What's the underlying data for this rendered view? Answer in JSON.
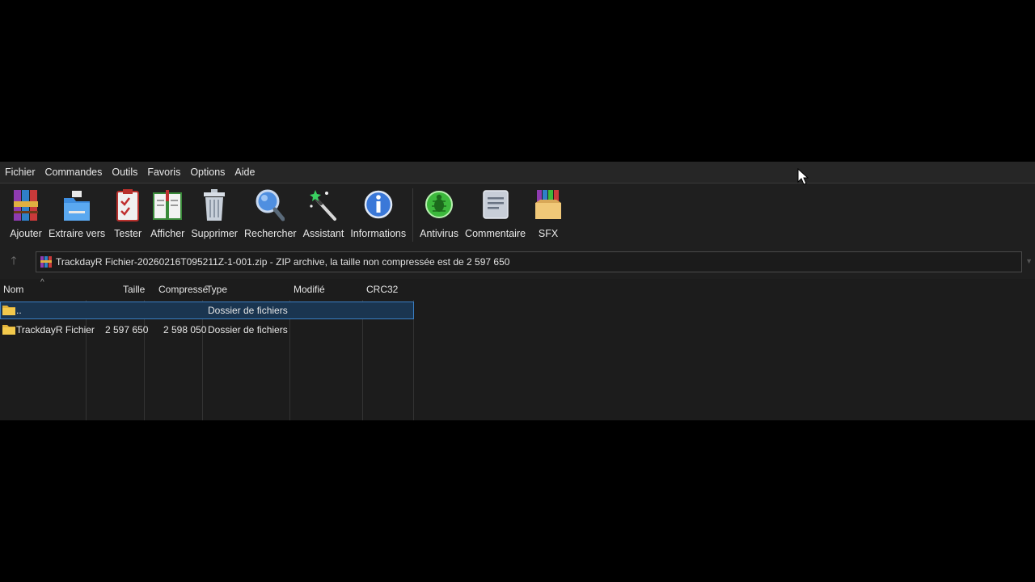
{
  "menubar": {
    "items": [
      "Fichier",
      "Commandes",
      "Outils",
      "Favoris",
      "Options",
      "Aide"
    ]
  },
  "toolbar": {
    "buttons": [
      {
        "label": "Ajouter",
        "icon": "winrar-books-icon"
      },
      {
        "label": "Extraire vers",
        "icon": "extract-folder-icon"
      },
      {
        "label": "Tester",
        "icon": "clipboard-check-icon"
      },
      {
        "label": "Afficher",
        "icon": "open-book-icon"
      },
      {
        "label": "Supprimer",
        "icon": "trash-can-icon"
      },
      {
        "label": "Rechercher",
        "icon": "magnifier-icon"
      },
      {
        "label": "Assistant",
        "icon": "magic-wand-icon"
      },
      {
        "label": "Informations",
        "icon": "info-icon"
      },
      {
        "label": "Antivirus",
        "icon": "bug-shield-icon"
      },
      {
        "label": "Commentaire",
        "icon": "comment-icon"
      },
      {
        "label": "SFX",
        "icon": "sfx-box-icon"
      }
    ]
  },
  "address": {
    "text": "TrackdayR Fichier-20260216T095211Z-1-001.zip - ZIP archive, la taille non compressée est de 2 597 650"
  },
  "file_list": {
    "columns": [
      "Nom",
      "Taille",
      "Compressé",
      "Type",
      "Modifié",
      "CRC32"
    ],
    "sort_indicator": "^",
    "rows": [
      {
        "name": "..",
        "size": "",
        "packed": "",
        "type": "Dossier de fichiers",
        "modified": "",
        "crc": "",
        "selected": true
      },
      {
        "name": "TrackdayR Fichier",
        "size": "2 597 650",
        "packed": "2 598 050",
        "type": "Dossier de fichiers",
        "modified": "",
        "crc": "",
        "selected": false
      }
    ]
  },
  "colors": {
    "window_bg": "#1f1f1f",
    "selection_bg": "#1a3550",
    "selection_border": "#3a7fc4",
    "folder_yellow": "#f2c94c"
  }
}
